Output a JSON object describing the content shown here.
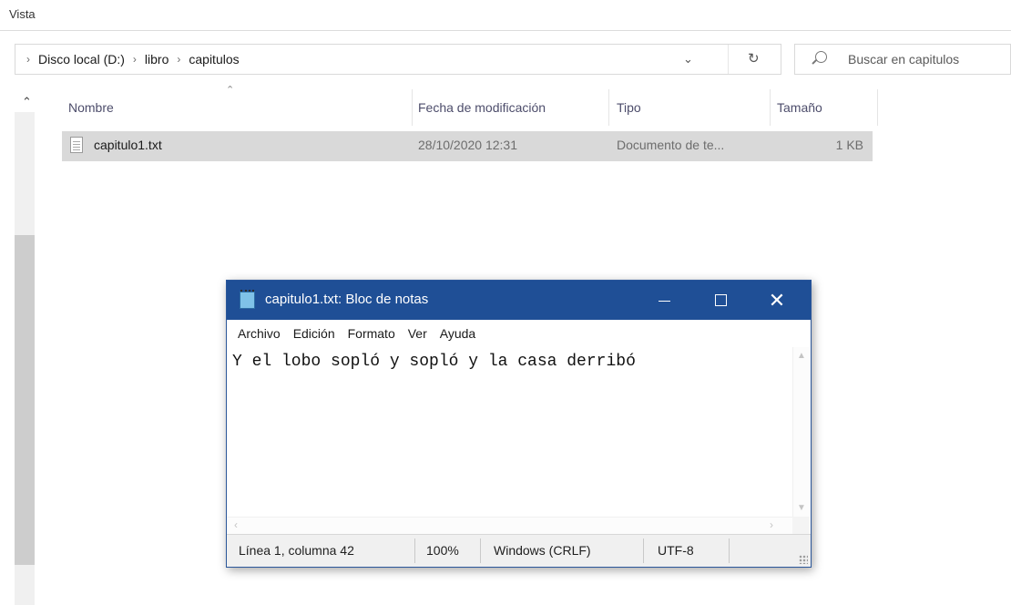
{
  "ribbon": {
    "tab_view": "Vista"
  },
  "address": {
    "crumbs": [
      "Disco local (D:)",
      "libro",
      "capitulos"
    ],
    "lead_separator": "›",
    "separator": "›"
  },
  "search": {
    "placeholder": "Buscar en capitulos"
  },
  "columns": {
    "name": "Nombre",
    "modified": "Fecha de modificación",
    "type": "Tipo",
    "size": "Tamaño"
  },
  "files": [
    {
      "name": "capitulo1.txt",
      "modified": "28/10/2020 12:31",
      "type": "Documento de te...",
      "size": "1 KB"
    }
  ],
  "notepad": {
    "title": "capitulo1.txt: Bloc de notas",
    "menu": [
      "Archivo",
      "Edición",
      "Formato",
      "Ver",
      "Ayuda"
    ],
    "content": "Y el lobo sopló y sopló y la casa derribó",
    "status": {
      "position": "Línea 1, columna 42",
      "zoom": "100%",
      "line_endings": "Windows (CRLF)",
      "encoding": "UTF-8"
    }
  },
  "colors": {
    "titlebar": "#1f4f96",
    "selection": "#d9d9d9"
  }
}
